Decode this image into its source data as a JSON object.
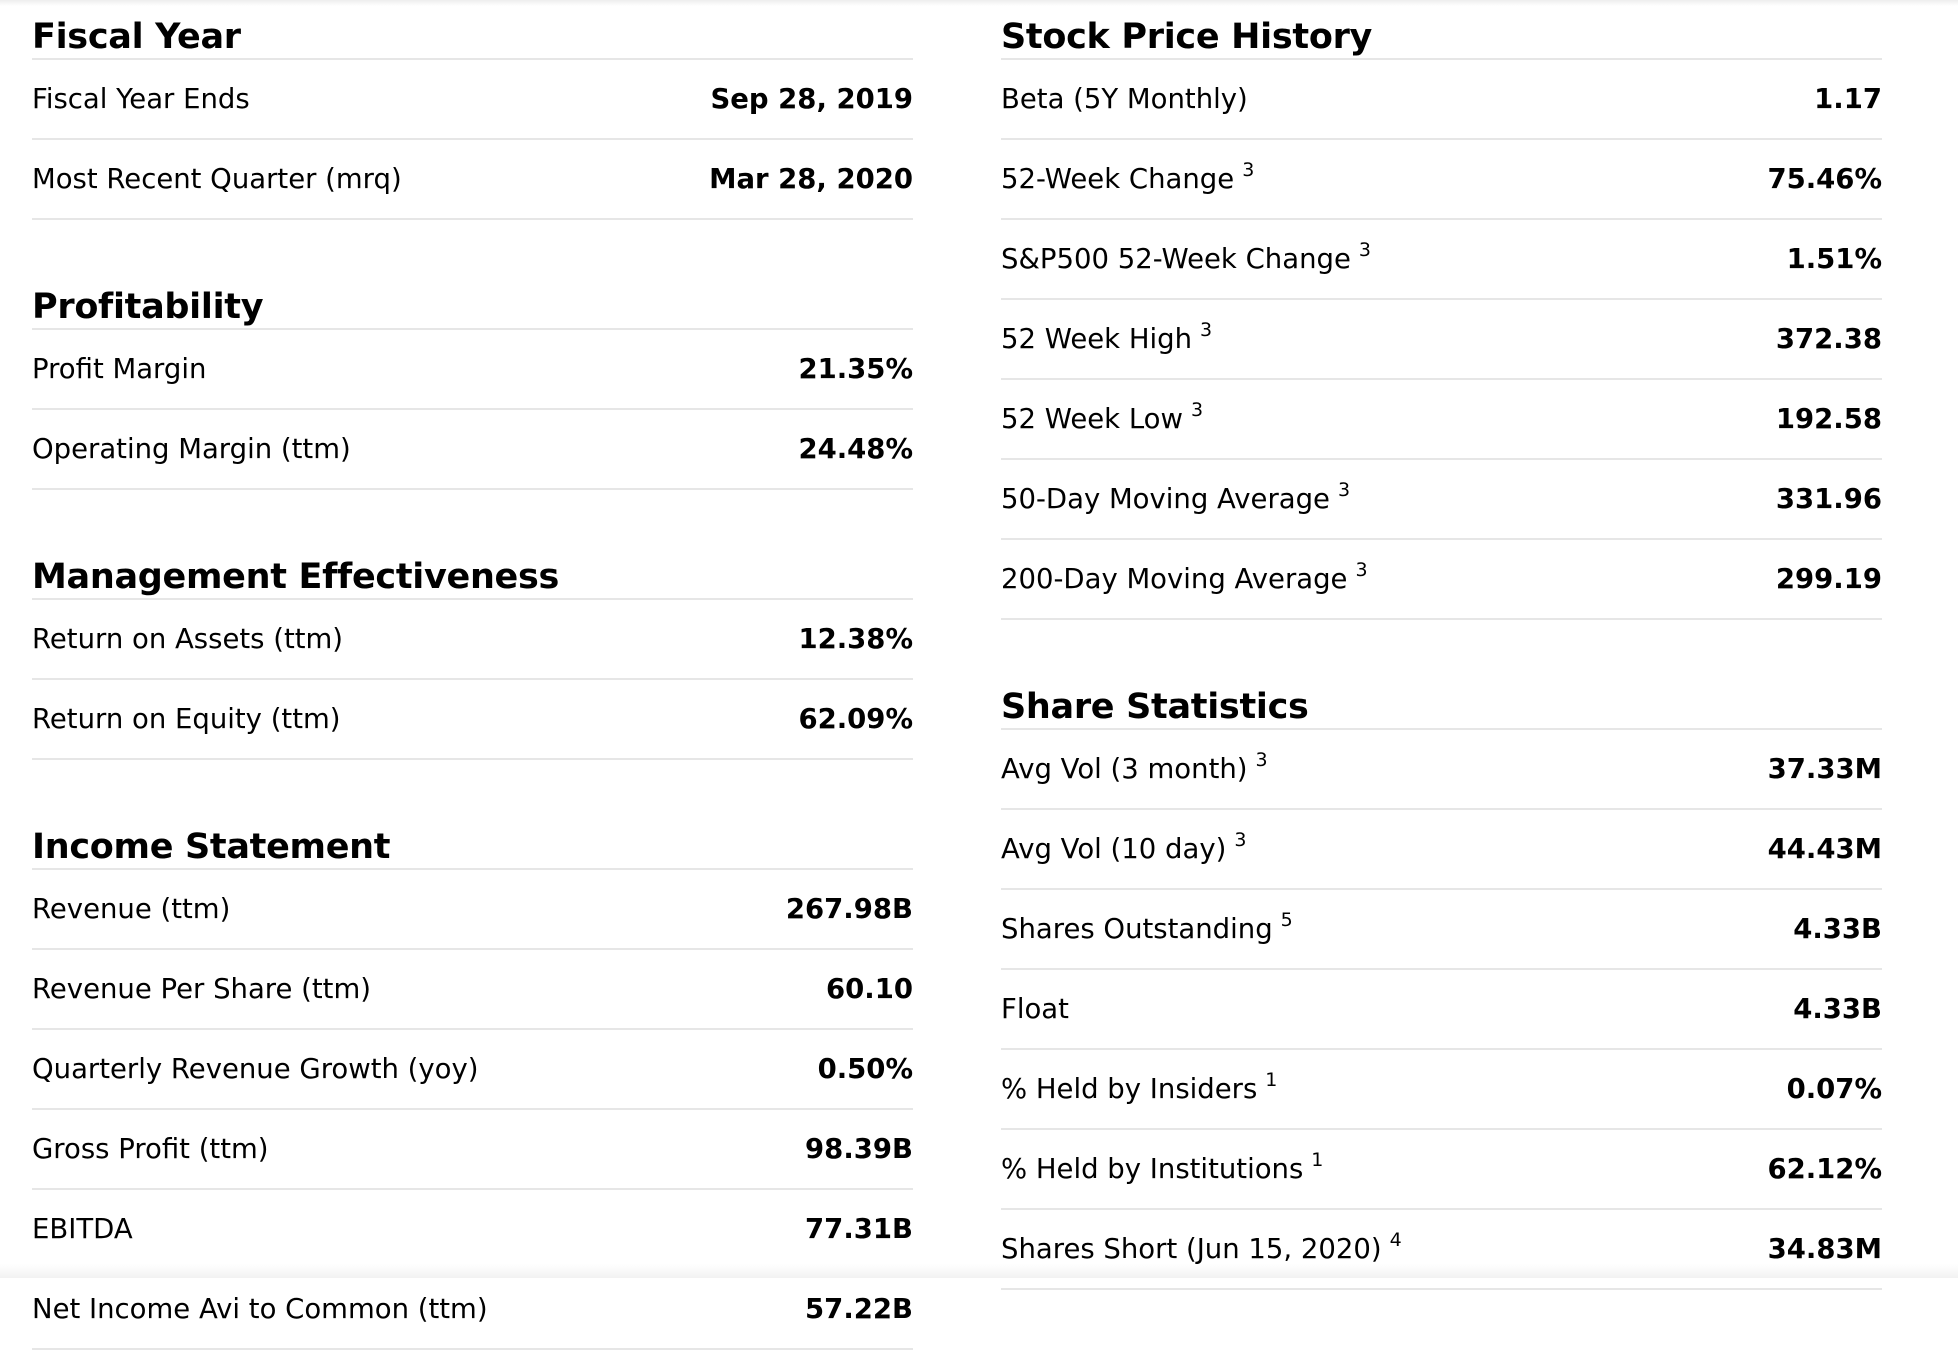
{
  "left_sections": [
    {
      "title": "Fiscal Year",
      "rows": [
        {
          "label": "Fiscal Year Ends",
          "footnote": "",
          "value": "Sep 28, 2019"
        },
        {
          "label": "Most Recent Quarter (mrq)",
          "footnote": "",
          "value": "Mar 28, 2020"
        }
      ]
    },
    {
      "title": "Profitability",
      "rows": [
        {
          "label": "Profit Margin",
          "footnote": "",
          "value": "21.35%"
        },
        {
          "label": "Operating Margin (ttm)",
          "footnote": "",
          "value": "24.48%"
        }
      ]
    },
    {
      "title": "Management Effectiveness",
      "rows": [
        {
          "label": "Return on Assets (ttm)",
          "footnote": "",
          "value": "12.38%"
        },
        {
          "label": "Return on Equity (ttm)",
          "footnote": "",
          "value": "62.09%"
        }
      ]
    },
    {
      "title": "Income Statement",
      "rows": [
        {
          "label": "Revenue (ttm)",
          "footnote": "",
          "value": "267.98B"
        },
        {
          "label": "Revenue Per Share (ttm)",
          "footnote": "",
          "value": "60.10"
        },
        {
          "label": "Quarterly Revenue Growth (yoy)",
          "footnote": "",
          "value": "0.50%"
        },
        {
          "label": "Gross Profit (ttm)",
          "footnote": "",
          "value": "98.39B"
        },
        {
          "label": "EBITDA",
          "footnote": "",
          "value": "77.31B"
        },
        {
          "label": "Net Income Avi to Common (ttm)",
          "footnote": "",
          "value": "57.22B"
        }
      ]
    }
  ],
  "right_sections": [
    {
      "title": "Stock Price History",
      "rows": [
        {
          "label": "Beta (5Y Monthly)",
          "footnote": "",
          "value": "1.17"
        },
        {
          "label": "52-Week Change",
          "footnote": "3",
          "value": "75.46%"
        },
        {
          "label": "S&P500 52-Week Change",
          "footnote": "3",
          "value": "1.51%"
        },
        {
          "label": "52 Week High",
          "footnote": "3",
          "value": "372.38"
        },
        {
          "label": "52 Week Low",
          "footnote": "3",
          "value": "192.58"
        },
        {
          "label": "50-Day Moving Average",
          "footnote": "3",
          "value": "331.96"
        },
        {
          "label": "200-Day Moving Average",
          "footnote": "3",
          "value": "299.19"
        }
      ]
    },
    {
      "title": "Share Statistics",
      "rows": [
        {
          "label": "Avg Vol (3 month)",
          "footnote": "3",
          "value": "37.33M"
        },
        {
          "label": "Avg Vol (10 day)",
          "footnote": "3",
          "value": "44.43M"
        },
        {
          "label": "Shares Outstanding",
          "footnote": "5",
          "value": "4.33B"
        },
        {
          "label": "Float",
          "footnote": "",
          "value": "4.33B"
        },
        {
          "label": "% Held by Insiders",
          "footnote": "1",
          "value": "0.07%"
        },
        {
          "label": "% Held by Institutions",
          "footnote": "1",
          "value": "62.12%"
        },
        {
          "label": "Shares Short (Jun 15, 2020)",
          "footnote": "4",
          "value": "34.83M"
        }
      ]
    }
  ]
}
